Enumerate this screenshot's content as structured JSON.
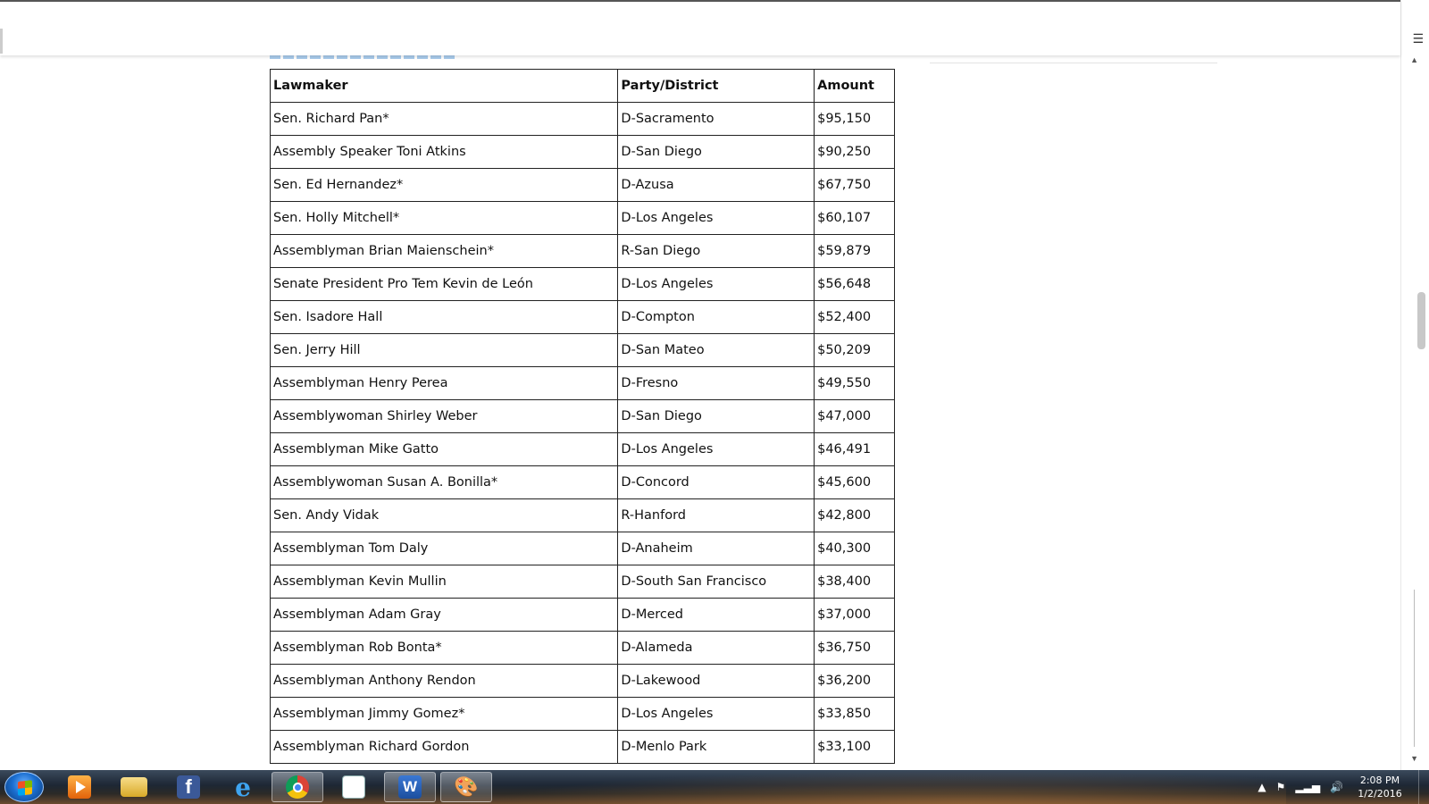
{
  "table": {
    "headers": [
      "Lawmaker",
      "Party/District",
      "Amount"
    ],
    "rows": [
      [
        "Sen. Richard Pan*",
        "D-Sacramento",
        "$95,150"
      ],
      [
        "Assembly Speaker Toni Atkins",
        "D-San Diego",
        "$90,250"
      ],
      [
        "Sen. Ed Hernandez*",
        "D-Azusa",
        "$67,750"
      ],
      [
        "Sen. Holly Mitchell*",
        "D-Los Angeles",
        "$60,107"
      ],
      [
        "Assemblyman Brian Maienschein*",
        "R-San Diego",
        "$59,879"
      ],
      [
        "Senate President Pro Tem Kevin de León",
        "D-Los Angeles",
        "$56,648"
      ],
      [
        "Sen. Isadore Hall",
        "D-Compton",
        "$52,400"
      ],
      [
        "Sen. Jerry Hill",
        "D-San Mateo",
        "$50,209"
      ],
      [
        "Assemblyman Henry Perea",
        "D-Fresno",
        "$49,550"
      ],
      [
        "Assemblywoman Shirley Weber",
        "D-San Diego",
        "$47,000"
      ],
      [
        "Assemblyman Mike Gatto",
        "D-Los Angeles",
        "$46,491"
      ],
      [
        "Assemblywoman Susan A. Bonilla*",
        "D-Concord",
        "$45,600"
      ],
      [
        "Sen. Andy Vidak",
        "R-Hanford",
        "$42,800"
      ],
      [
        "Assemblyman Tom Daly",
        "D-Anaheim",
        "$40,300"
      ],
      [
        "Assemblyman Kevin Mullin",
        "D-South San Francisco",
        "$38,400"
      ],
      [
        "Assemblyman Adam Gray",
        "D-Merced",
        "$37,000"
      ],
      [
        "Assemblyman Rob Bonta*",
        "D-Alameda",
        "$36,750"
      ],
      [
        "Assemblyman Anthony Rendon",
        "D-Lakewood",
        "$36,200"
      ],
      [
        "Assemblyman Jimmy Gomez*",
        "D-Los Angeles",
        "$33,850"
      ],
      [
        "Assemblyman Richard Gordon",
        "D-Menlo Park",
        "$33,100"
      ]
    ]
  },
  "scrollbar": {
    "menu_icon": "hamburger-menu-icon"
  },
  "taskbar": {
    "apps": [
      {
        "name": "media-player-icon",
        "active": false
      },
      {
        "name": "file-explorer-icon",
        "active": false
      },
      {
        "name": "facebook-icon",
        "glyph": "f",
        "active": false
      },
      {
        "name": "internet-explorer-icon",
        "glyph": "e",
        "active": false
      },
      {
        "name": "chrome-icon",
        "active": true
      },
      {
        "name": "news-app-icon",
        "active": false
      },
      {
        "name": "word-icon",
        "glyph": "W",
        "active": true
      },
      {
        "name": "paint-icon",
        "active": true
      }
    ],
    "clock": {
      "time": "2:08 PM",
      "date": "1/2/2016"
    }
  },
  "colors": {
    "taskbar_top": "#3b4a5c",
    "table_border": "#222222",
    "heading_accent": "#9fc6ea"
  }
}
